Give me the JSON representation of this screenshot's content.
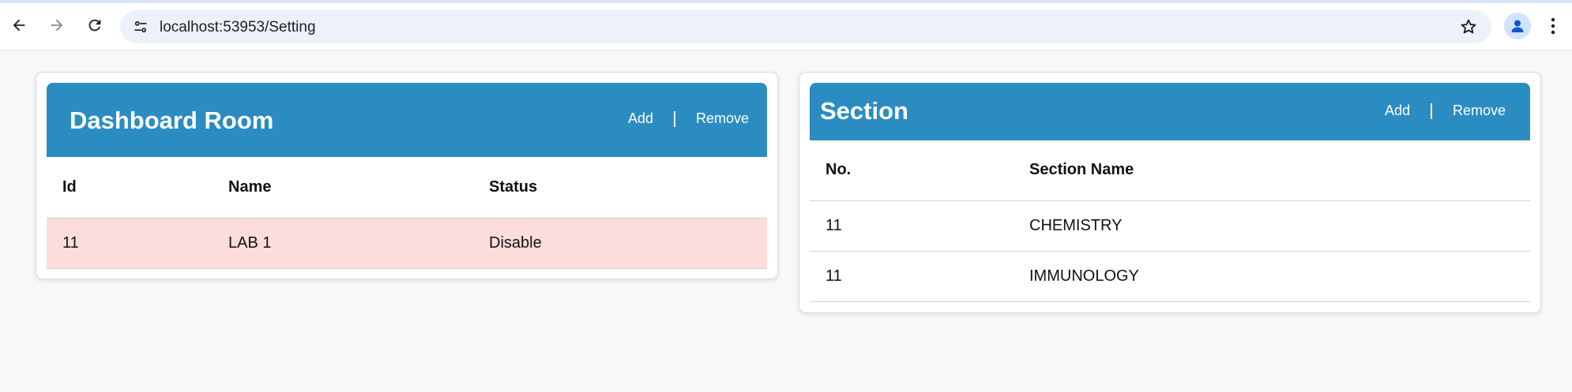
{
  "browser": {
    "url": "localhost:53953/Setting",
    "icons": {
      "back": "arrow-left-icon",
      "forward": "arrow-right-icon",
      "reload": "reload-icon",
      "site_info": "tune-icon",
      "bookmark": "star-icon",
      "profile": "person-icon",
      "menu": "more-vert-icon"
    }
  },
  "colors": {
    "header": "#2b8cc1",
    "disabled_row": "#fddcdc",
    "page_bg": "#f7f8fa"
  },
  "room": {
    "title": "Dashboard Room",
    "add_label": "Add",
    "remove_label": "Remove",
    "columns": [
      "Id",
      "Name",
      "Status"
    ],
    "rows": [
      {
        "id": "11",
        "name": "LAB 1",
        "status": "Disable"
      }
    ]
  },
  "section": {
    "title": "Section",
    "add_label": "Add",
    "remove_label": "Remove",
    "columns": [
      "No.",
      "Section Name"
    ],
    "rows": [
      {
        "no": "11",
        "name": "CHEMISTRY"
      },
      {
        "no": "11",
        "name": "IMMUNOLOGY"
      }
    ]
  }
}
